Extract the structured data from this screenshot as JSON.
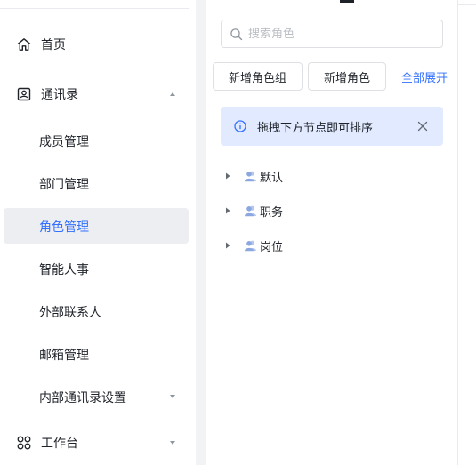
{
  "sidebar": {
    "items": [
      {
        "label": "首页",
        "icon": "home-icon"
      },
      {
        "label": "通讯录",
        "icon": "contacts-icon",
        "caret": "caret-up-icon"
      },
      {
        "label": "工作台",
        "icon": "workbench-icon",
        "caret": "caret-down-icon"
      }
    ],
    "contacts_children": [
      {
        "label": "成员管理"
      },
      {
        "label": "部门管理"
      },
      {
        "label": "角色管理",
        "active": true
      },
      {
        "label": "智能人事"
      },
      {
        "label": "外部联系人"
      },
      {
        "label": "邮箱管理"
      },
      {
        "label": "内部通讯录设置",
        "caret": "caret-down-icon"
      }
    ]
  },
  "panel": {
    "search": {
      "placeholder": "搜索角色",
      "value": ""
    },
    "buttons": {
      "add_group": "新增角色组",
      "add_role": "新增角色"
    },
    "expand_all": "全部展开",
    "notice": {
      "text": "拖拽下方节点即可排序",
      "icon": "info-icon",
      "close_icon": "close-icon"
    },
    "tree": [
      {
        "label": "默认",
        "icon": "role-group-icon"
      },
      {
        "label": "职务",
        "icon": "role-group-icon"
      },
      {
        "label": "岗位",
        "icon": "role-group-icon"
      }
    ]
  },
  "colors": {
    "accent": "#3370ff",
    "active_bg": "#eceef2",
    "notice_bg": "#e1eaff",
    "divider": "#f2f3f5",
    "text": "#1f2329",
    "muted_icon": "#8f959e"
  }
}
